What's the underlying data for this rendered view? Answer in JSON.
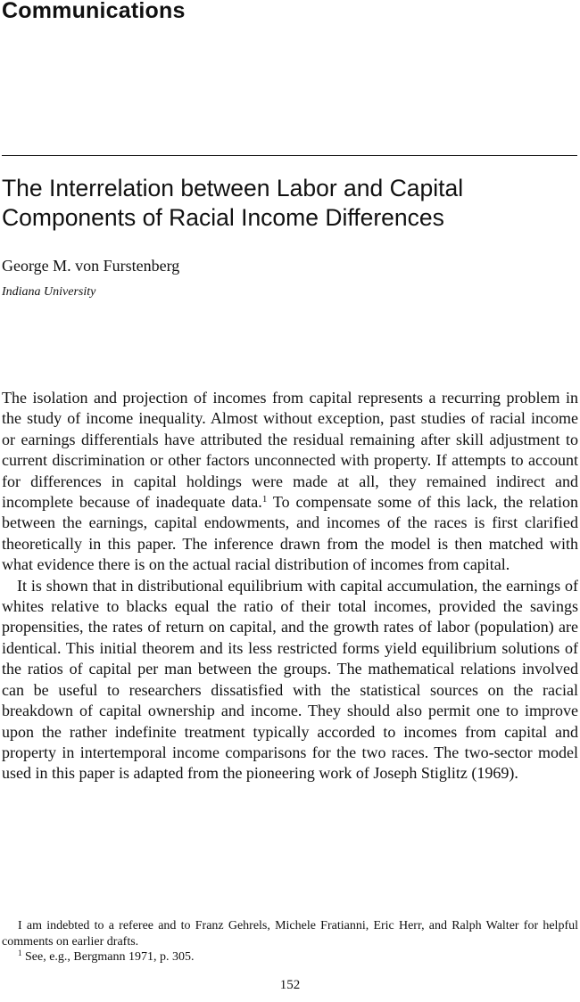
{
  "header": {
    "section": "Communications"
  },
  "article": {
    "title_line1": "The Interrelation between Labor and Capital",
    "title_line2": "Components of Racial Income Differences",
    "author": "George M. von Furstenberg",
    "affiliation": "Indiana University"
  },
  "body": {
    "p1_text": "The isolation and projection of incomes from capital represents a recurring problem in the study of income inequality. Almost without exception, past studies of racial income or earnings differentials have attributed the residual remaining after skill adjustment to current discrimination or other factors unconnected with property. If attempts to account for differences in capital holdings were made at all, they remained indirect and incomplete because of inadequate data.",
    "p1_footnote_mark": "1",
    "p1_text_cont": " To compensate some of this lack, the relation between the earnings, capital endowments, and incomes of the races is first clarified theoretically in this paper. The inference drawn from the model is then matched with what evidence there is on the actual racial distribution of incomes from capital.",
    "p2_text": "It is shown that in distributional equilibrium with capital accumulation, the earnings of whites relative to blacks equal the ratio of their total incomes, provided the savings propensities, the rates of return on capital, and the growth rates of labor (population) are identical. This initial theorem and its less restricted forms yield equilibrium solutions of the ratios of capital per man between the groups. The mathematical relations involved can be useful to researchers dissatisfied with the statistical sources on the racial breakdown of capital ownership and income. They should also permit one to improve upon the rather indefinite treatment typically accorded to incomes from capital and property in intertemporal income comparisons for the two races. The two-sector model used in this paper is adapted from the pioneering work of Joseph Stiglitz (1969)."
  },
  "footnotes": {
    "acknowledgment": "I am indebted to a referee and to Franz Gehrels, Michele Fratianni, Eric Herr, and Ralph Walter for helpful comments on earlier drafts.",
    "fn1_mark": "1",
    "fn1_text": " See, e.g., Bergmann 1971, p. 305."
  },
  "page": {
    "number": "152"
  }
}
